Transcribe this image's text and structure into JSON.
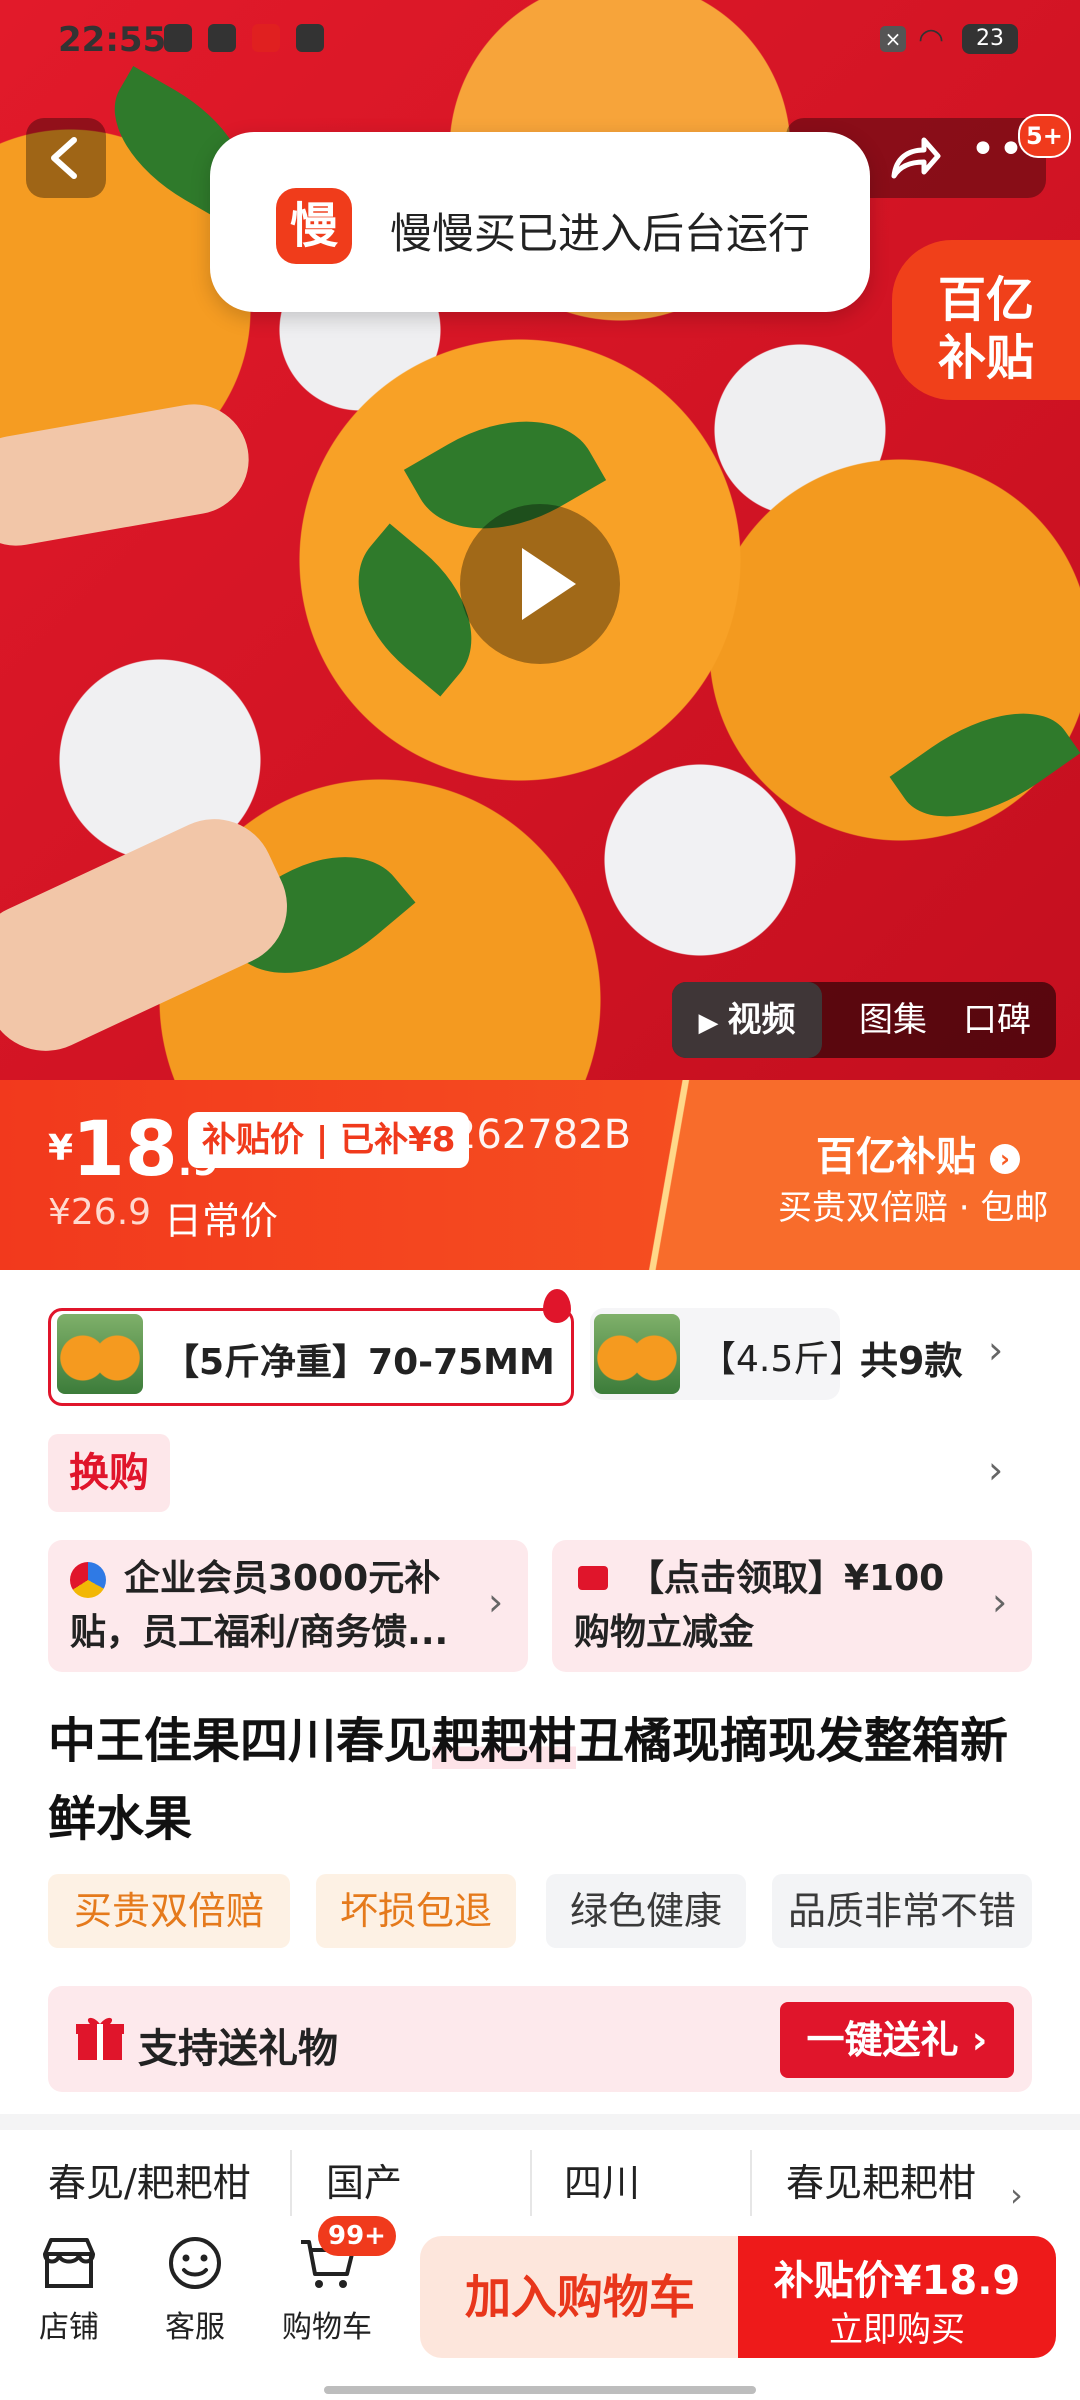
{
  "status_bar": {
    "time": "22:55",
    "battery": "23"
  },
  "toast": {
    "logo_char": "慢",
    "message": "慢慢买已进入后台运行"
  },
  "hero": {
    "cart_badge": "5+",
    "subsidy_badge_line1": "百亿",
    "subsidy_badge_line2": "补贴",
    "media_tabs": [
      "视频",
      "图集",
      "口碑"
    ],
    "active_media_tab": "视频"
  },
  "price": {
    "currency": "¥",
    "amount": "18",
    "decimal": ".9",
    "subsidy_pill": "补贴价 | 已补¥8",
    "code_overlay": "69262782B",
    "original": "¥26.9",
    "daily_label": "日常价",
    "brand_title": "百亿补贴",
    "brand_sub": "买贵双倍赔 · 包邮"
  },
  "sku": {
    "selected": "【5斤净重】70-75MM",
    "second": "【4.5斤】",
    "total": "共9款"
  },
  "exchange_tag": "换购",
  "promos": [
    {
      "line1": "企业会员3000元补",
      "line2": "贴，员工福利/商务馈..."
    },
    {
      "line1": "【点击领取】¥100",
      "line2": "购物立减金"
    }
  ],
  "product_title": {
    "part1": "中王佳果四川春见",
    "highlight": "耙耙柑",
    "part2": "丑橘现摘现发整箱新鲜水果"
  },
  "service_chips": [
    {
      "label": "买贵双倍赔",
      "style": "orange"
    },
    {
      "label": "坏损包退",
      "style": "orange"
    },
    {
      "label": "绿色健康",
      "style": "gray"
    },
    {
      "label": "品质非常不错",
      "style": "gray"
    }
  ],
  "gift": {
    "label": "支持送礼物",
    "button": "一键送礼"
  },
  "attributes": [
    "春见/耙耙柑",
    "国产",
    "四川",
    "春见耙耙柑"
  ],
  "bottom_nav": [
    {
      "label": "店铺",
      "icon": "store-icon"
    },
    {
      "label": "客服",
      "icon": "service-icon"
    },
    {
      "label": "购物车",
      "icon": "cart-icon"
    }
  ],
  "cart_count_badge": "99+",
  "add_to_cart": "加入购物车",
  "buy": {
    "price_label": "补贴价¥18.9",
    "action": "立即购买"
  },
  "colors": {
    "accent": "#e0152b",
    "brand_orange": "#f2391d"
  }
}
